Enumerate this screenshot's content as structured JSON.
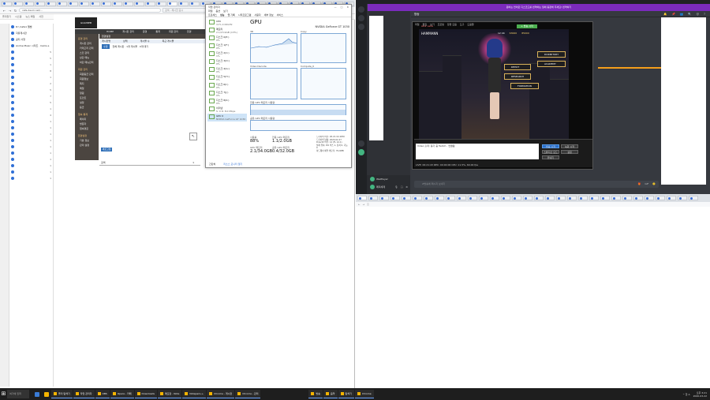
{
  "left_browser": {
    "tabs": [
      "",
      "",
      "",
      "",
      "",
      "",
      "",
      "",
      "",
      "",
      "",
      "",
      "",
      "",
      "",
      "",
      "",
      "",
      "",
      "",
      "",
      "",
      "",
      "",
      "",
      "",
      "",
      "",
      "",
      "",
      "",
      "",
      ""
    ],
    "address": "cafe.daum.net/...",
    "search_placeholder": "검색 - 채시한 표시",
    "bookmarks": [
      "즐겨찾기",
      "시스템",
      "뉴스 메일",
      "사전"
    ],
    "tree": [
      {
        "label": "D:\\ Cafe1 앨범",
        "count": ""
      },
      {
        "label": "자유게시판",
        "count": ""
      },
      {
        "label": "공지 사항",
        "count": ""
      },
      {
        "label": "Anime Music 시리즈 · Cams e",
        "count": ""
      },
      {
        "label": "",
        "count": "5"
      },
      {
        "label": "",
        "count": "5"
      },
      {
        "label": "",
        "count": "1"
      },
      {
        "label": "",
        "count": "8"
      },
      {
        "label": "",
        "count": "1"
      },
      {
        "label": "",
        "count": "2"
      },
      {
        "label": "",
        "count": "5"
      },
      {
        "label": "",
        "count": "7"
      },
      {
        "label": "",
        "count": "5"
      },
      {
        "label": "",
        "count": "1"
      },
      {
        "label": "",
        "count": "4"
      },
      {
        "label": "",
        "count": "1"
      },
      {
        "label": "",
        "count": "1"
      },
      {
        "label": "",
        "count": "1"
      },
      {
        "label": "",
        "count": "1"
      },
      {
        "label": "",
        "count": "1"
      },
      {
        "label": "",
        "count": "1"
      },
      {
        "label": "",
        "count": "1"
      },
      {
        "label": "",
        "count": "1"
      },
      {
        "label": "",
        "count": "1"
      },
      {
        "label": "",
        "count": "1"
      }
    ]
  },
  "webpage": {
    "logo": "GULIWEB",
    "nav": [
      "HOME",
      "게시판 관리",
      "운영",
      "통계",
      "회원 관리",
      "환경"
    ],
    "menu_sections": [
      {
        "header": "운영 관리",
        "items": [
          "게시판 관리",
          "카테고리 관리",
          "스킨 관리",
          "상단 메뉴",
          "하단 메뉴관리"
        ]
      },
      {
        "header": "회원 관리",
        "items": [
          "회원등급 관리",
          "회원정보",
          "쪽지",
          "메일",
          "알림",
          "포인트",
          "설정",
          "등급"
        ]
      },
      {
        "header": "접속 통계",
        "items": [
          "페이지",
          "방문자",
          "접속경로"
        ]
      },
      {
        "header": "환경설정",
        "items": [
          "기본 정보",
          "관리 설정"
        ]
      }
    ],
    "content_title": "환경설정",
    "grid_headers": [
      "게시판명",
      "상태",
      "게시물 수",
      "최근 게시물"
    ],
    "grid_row": {
      "button": "수정",
      "text": "전체 게시판 · 1개 게시물 · 0개 대기"
    },
    "refresh_label": "새로고침",
    "search_label": "검색",
    "page": "1"
  },
  "task_manager": {
    "title": "작업 관리자",
    "controls": [
      "—",
      "□",
      "✕"
    ],
    "menu": [
      "파일",
      "옵션",
      "보기"
    ],
    "tabs": [
      "프로세스",
      "성능",
      "앱 기록",
      "시작프로그램",
      "사용자",
      "세부 정보",
      "서비스"
    ],
    "items": [
      {
        "name": "CPU",
        "sub": "11% 2.00GHz"
      },
      {
        "name": "메모리",
        "sub": "2.1/15.9GB (13%)"
      },
      {
        "name": "디스크 0(E:)",
        "sub": "0%"
      },
      {
        "name": "디스크 1(F:)",
        "sub": "0%"
      },
      {
        "name": "디스크 2(C:)",
        "sub": "1%"
      },
      {
        "name": "디스크 3(D:)",
        "sub": "0%"
      },
      {
        "name": "디스크 4(G:)",
        "sub": "0%"
      },
      {
        "name": "디스크 5(H:)",
        "sub": "0%"
      },
      {
        "name": "디스크 6(I:)",
        "sub": "0%"
      },
      {
        "name": "디스크 7(J:)",
        "sub": "0%"
      },
      {
        "name": "디스크 8(K:)",
        "sub": "0%"
      },
      {
        "name": "이더넷",
        "sub": "S: 0 R: 8.0 Mbps"
      },
      {
        "name": "GPU 0",
        "sub": "NVIDIA GeForce GT 1030 · 88%"
      }
    ],
    "gpu_heading": "GPU",
    "gpu_model": "NVIDIA GeForce GT 1030",
    "graph_labels": [
      "3D",
      "Copy",
      "Video Decode",
      "Compute_0",
      "전용 GPU 메모리 사용량",
      "공유 GPU 메모리 사용량"
    ],
    "stats": [
      {
        "label": "사용률",
        "value": "88%"
      },
      {
        "label": "전용 GPU 메모리",
        "value": "1.1/2.0GB"
      },
      {
        "label": "GPU 메모리",
        "value": "2.1/34.0GB"
      },
      {
        "label": "공유 GPU 메모리",
        "value": "0.4/32.0GB"
      }
    ],
    "details": [
      "드라이버 버전: 26.21.14.4250",
      "드라이버 날짜: 2020-02-27",
      "DirectX 버전: 12 (FL 12.1)",
      "실제 위치: PCI 버스 1, 장치 0, 기능 0",
      "하드웨어 예약 메모리: 79.0MB"
    ],
    "footer_less": "간단히",
    "footer_link": "리소스 모니터 열기"
  },
  "discord": {
    "banner": "원하는 언어로 디스코드를 번역하는 일에 동참해 주세요!  번역하기",
    "channel": "방송",
    "header_icons": [
      "🔔",
      "📌",
      "👥",
      "🔍",
      "@",
      "?"
    ],
    "users": [
      {
        "name": "WeiPlayer"
      },
      {
        "name": "페피세계"
      }
    ],
    "input_placeholder": "#방송에 메시지 보내기",
    "input_icons": [
      "🎁",
      "GIF",
      "🙂"
    ]
  },
  "stream": {
    "menu": [
      "파일",
      "편집",
      "보기",
      "프로필",
      "장면 모음",
      "도구",
      "도움말"
    ],
    "top_button": "+ 방송 시작",
    "game_title": "Azur Lane",
    "hud_name": "HAMMANN",
    "hud_top_right": [
      "12:44",
      "63000",
      "85000"
    ],
    "hud_buttons": [
      "DORMITORY",
      "DEPOT",
      "RESEARCH",
      "ACADEMY",
      "FORMATION"
    ],
    "scene_buttons": [
      "방송 시작",
      "녹화 시작",
      "스튜디오 모드",
      "설정",
      "끝내기"
    ],
    "text_panel": "Video 출력: 동기 중 Twitch · 연결됨",
    "status": "LIVE: 00:21:43  REC: 00:00:00  CPU: 11.5%, 60.00 fps"
  },
  "right_browser": {
    "tabs": [
      "",
      "",
      "",
      "",
      "",
      "",
      "",
      "",
      "",
      "",
      "",
      "",
      "",
      "",
      "",
      "",
      "",
      "",
      "",
      "",
      "",
      "",
      "",
      "",
      "",
      "",
      "",
      "",
      "",
      "",
      ""
    ],
    "address": "ⓘ"
  },
  "taskbar": {
    "search": "여기에 입력",
    "apps": [
      {
        "label": "폴더 탐색기"
      },
      {
        "label": "작업 관리자"
      },
      {
        "label": "OBS"
      },
      {
        "label": "Opera - 카페"
      },
      {
        "label": "Downloads"
      },
      {
        "label": "메모장 - Note"
      },
      {
        "label": "Notepad++"
      },
      {
        "label": "Chrome - 게시판"
      },
      {
        "label": "Chrome - 관리"
      }
    ],
    "right_apps": [
      {
        "label": "방송"
      },
      {
        "label": "음악"
      },
      {
        "label": "탐색기"
      },
      {
        "label": "Chrome"
      }
    ],
    "time": "오후 3:21",
    "date": "2020-03-22",
    "tray": "^ 한 A"
  },
  "colors": {
    "discord_bg": "#36393f",
    "discord_banner": "#7b2bbd",
    "taskbar": "#1e1e1e",
    "accent": "#2f6fd6"
  }
}
